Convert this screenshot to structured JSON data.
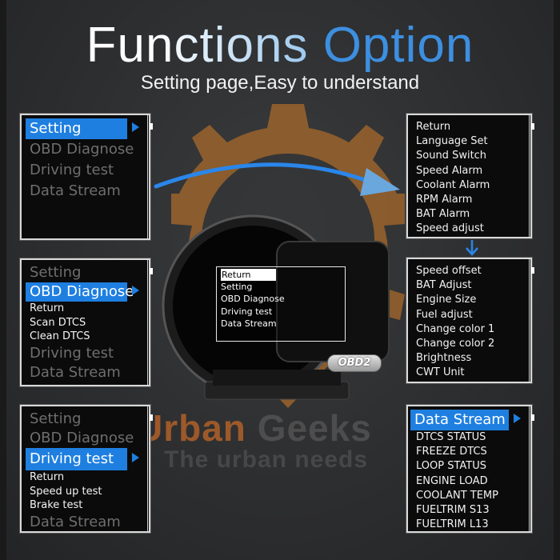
{
  "header": {
    "title_part1": "Functions",
    "title_part2": "Option",
    "subtitle": "Setting page,Easy to understand"
  },
  "colors": {
    "accent_blue": "#1e7fe0",
    "title_blue": "#3d8fe0",
    "watermark_orange": "#b06028",
    "panel_bg": "#0b0b0b"
  },
  "left_panels": [
    {
      "items": [
        {
          "label": "Setting",
          "selected": true
        },
        {
          "label": "OBD Diagnose",
          "selected": false
        },
        {
          "label": "Driving test",
          "selected": false
        },
        {
          "label": "Data Stream",
          "selected": false
        }
      ],
      "submenu": []
    },
    {
      "items": [
        {
          "label": "Setting",
          "selected": false
        },
        {
          "label": "OBD Diagnose",
          "selected": true
        },
        {
          "label": "Driving test",
          "selected": false
        },
        {
          "label": "Data Stream",
          "selected": false
        }
      ],
      "submenu": [
        "Return",
        "Scan DTCS",
        "Clean DTCS"
      ]
    },
    {
      "items": [
        {
          "label": "Setting",
          "selected": false
        },
        {
          "label": "OBD Diagnose",
          "selected": false
        },
        {
          "label": "Driving test",
          "selected": true
        },
        {
          "label": "Data Stream",
          "selected": false
        }
      ],
      "submenu": [
        "Return",
        "Speed up test",
        "Brake test"
      ]
    }
  ],
  "right_panels": {
    "settings_page1": [
      "Return",
      "Language Set",
      "Sound Switch",
      "Speed Alarm",
      "Coolant Alarm",
      "RPM Alarm",
      "BAT Alarm",
      "Speed adjust"
    ],
    "settings_page2": [
      "Speed offset",
      "BAT Adjust",
      "Engine Size",
      "Fuel adjust",
      "Change color 1",
      "Change color 2",
      "Brightness",
      "CWT Unit"
    ],
    "data_stream": {
      "header": "Data Stream",
      "items": [
        "DTCS STATUS",
        "FREEZE DTCS",
        "LOOP STATUS",
        "ENGINE LOAD",
        "COOLANT TEMP",
        "FUELTRIM S13",
        "FUELTRIM L13"
      ]
    }
  },
  "device": {
    "screen_items": [
      "Return",
      "Setting",
      "OBD Diagnose",
      "Driving test",
      "Data Stream"
    ],
    "badge": "OBD2"
  },
  "watermark": {
    "brand_part1": "Urban",
    "brand_part2": "Geeks",
    "tagline": "The urban needs"
  },
  "icons": {
    "curved_arrow": "arrow-right-icon",
    "down_arrow": "arrow-down-icon",
    "selection_triangle": "triangle-right-icon",
    "gear_watermark": "gear-icon"
  }
}
